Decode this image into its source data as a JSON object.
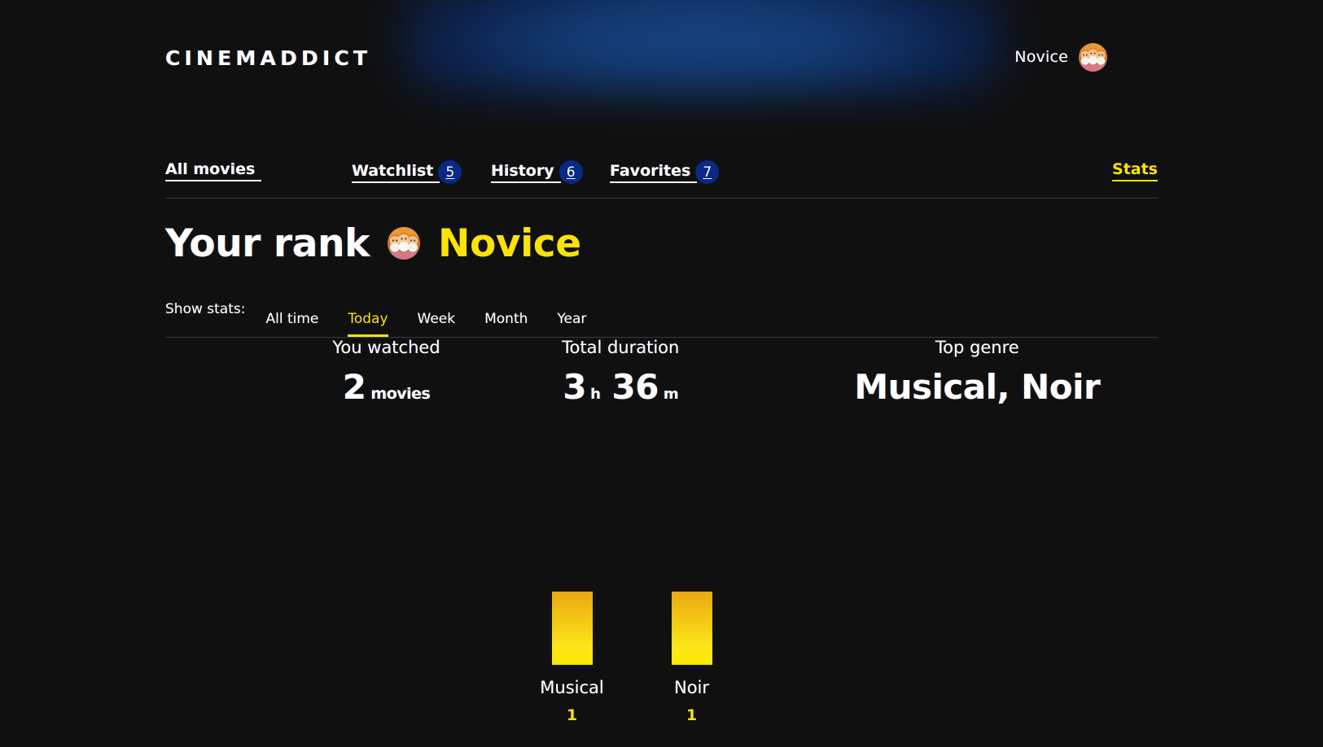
{
  "header": {
    "logo": "CINEMADDICT",
    "profile_rating": "Novice",
    "avatar_icon": "three-faces-avatar-icon"
  },
  "nav": {
    "items": [
      {
        "label": "All movies",
        "count": null,
        "active": true
      },
      {
        "label": "Watchlist",
        "count": "5",
        "active": false
      },
      {
        "label": "History",
        "count": "6",
        "active": false
      },
      {
        "label": "Favorites",
        "count": "7",
        "active": false
      }
    ],
    "stats_label": "Stats"
  },
  "statistics": {
    "rank_label": "Your rank",
    "rank_value": "Novice",
    "rank_color": "#fbe304",
    "filters_label": "Show stats:",
    "filters": [
      {
        "label": "All time",
        "active": false
      },
      {
        "label": "Today",
        "active": true
      },
      {
        "label": "Week",
        "active": false
      },
      {
        "label": "Month",
        "active": false
      },
      {
        "label": "Year",
        "active": false
      }
    ],
    "watched": {
      "title": "You watched",
      "value": "2",
      "unit": "movies"
    },
    "duration": {
      "title": "Total duration",
      "hours": "3",
      "hours_unit": "h",
      "minutes": "36",
      "minutes_unit": "m"
    },
    "top_genre": {
      "title": "Top genre",
      "value": "Musical, Noir"
    }
  },
  "chart_data": {
    "type": "bar",
    "categories": [
      "Musical",
      "Noir"
    ],
    "values": [
      1,
      1
    ],
    "title": "",
    "xlabel": "",
    "ylabel": "",
    "ylim": [
      0,
      1
    ],
    "grid": false,
    "legend": "none",
    "bar_color_top": "#e9a812",
    "bar_color_bottom": "#ffe800",
    "value_label_color": "#fbe304"
  }
}
